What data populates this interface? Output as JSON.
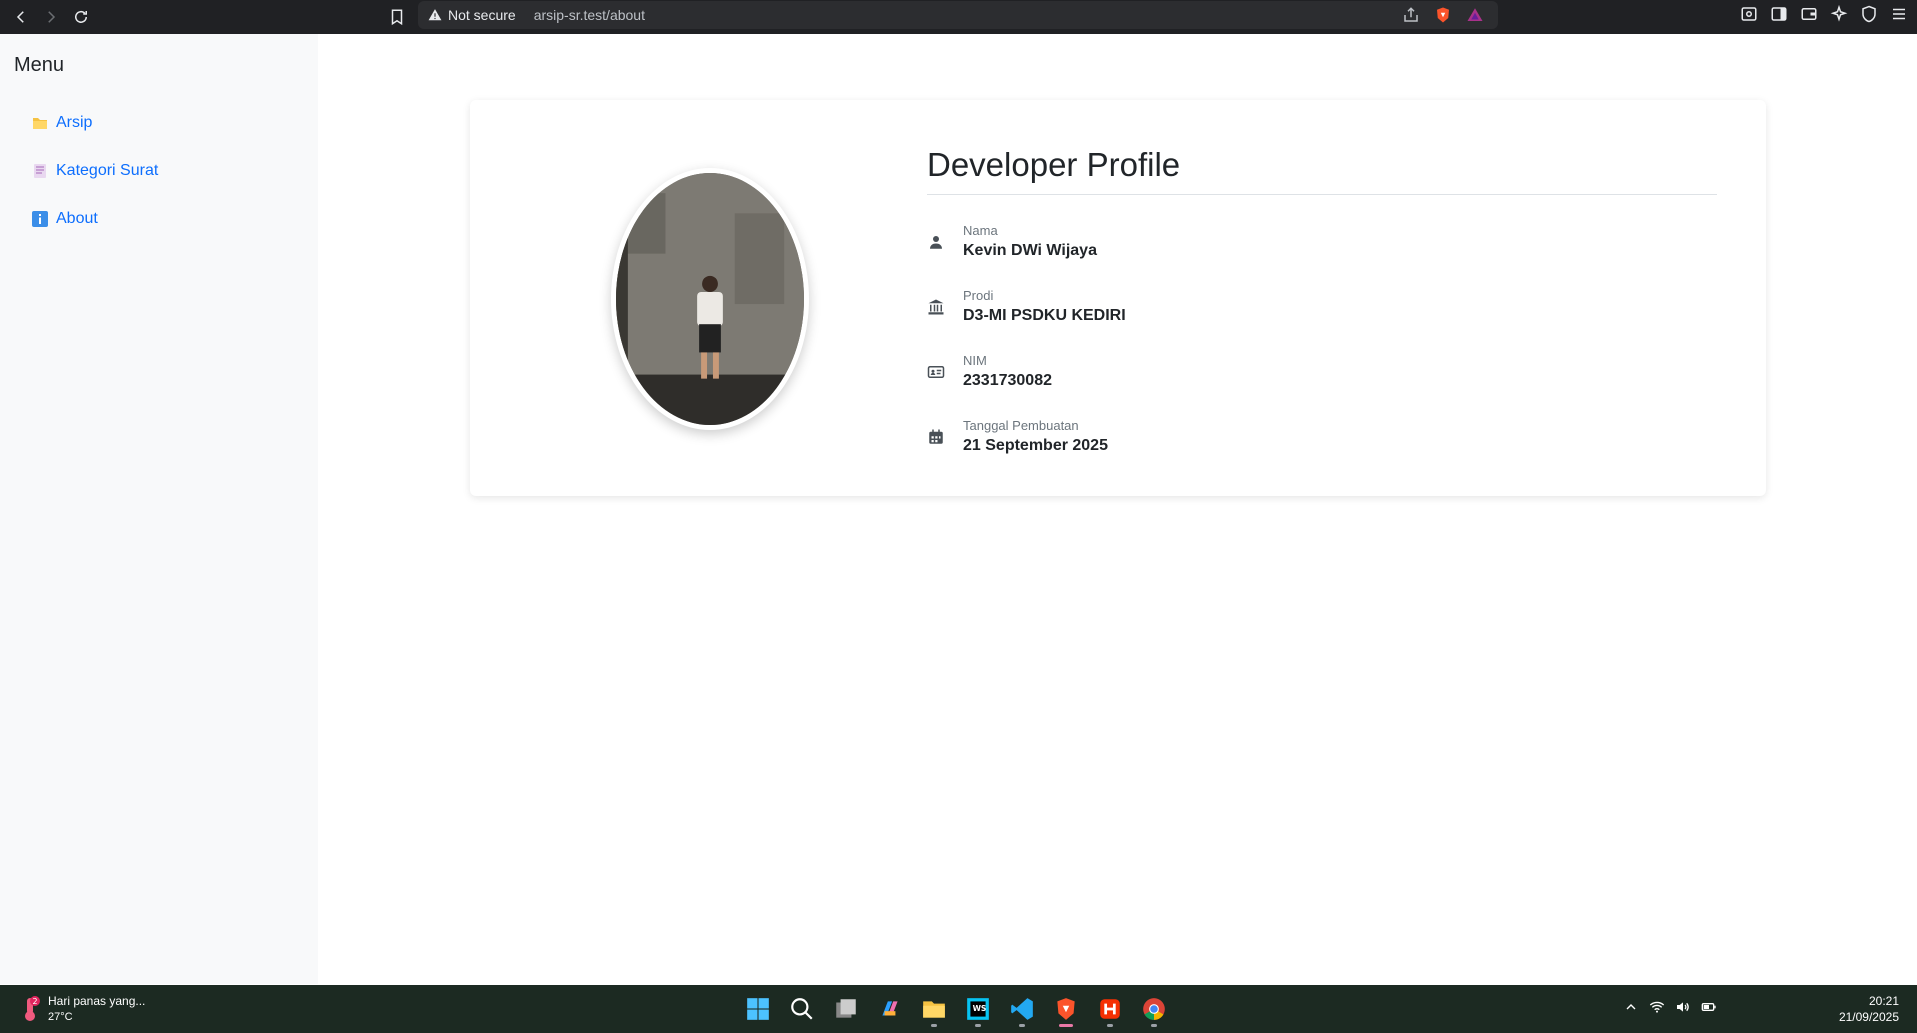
{
  "browser": {
    "security_label": "Not secure",
    "url": "arsip-sr.test/about"
  },
  "sidebar": {
    "title": "Menu",
    "items": [
      {
        "label": "Arsip",
        "icon": "folder-icon"
      },
      {
        "label": "Kategori Surat",
        "icon": "document-icon"
      },
      {
        "label": "About",
        "icon": "info-icon"
      }
    ]
  },
  "profile": {
    "title": "Developer Profile",
    "fields": [
      {
        "label": "Nama",
        "value": "Kevin DWi Wijaya",
        "icon": "user-icon"
      },
      {
        "label": "Prodi",
        "value": "D3-MI PSDKU KEDIRI",
        "icon": "university-icon"
      },
      {
        "label": "NIM",
        "value": "2331730082",
        "icon": "id-card-icon"
      },
      {
        "label": "Tanggal Pembuatan",
        "value": "21 September 2025",
        "icon": "calendar-icon"
      }
    ]
  },
  "taskbar": {
    "weather_text": "Hari panas yang...",
    "temperature": "27°C",
    "weather_badge": "2",
    "time": "20:21",
    "date": "21/09/2025"
  },
  "colors": {
    "link": "#0d6efd",
    "sidebar_bg": "#f8f9fa",
    "browser_bar": "#202124"
  }
}
